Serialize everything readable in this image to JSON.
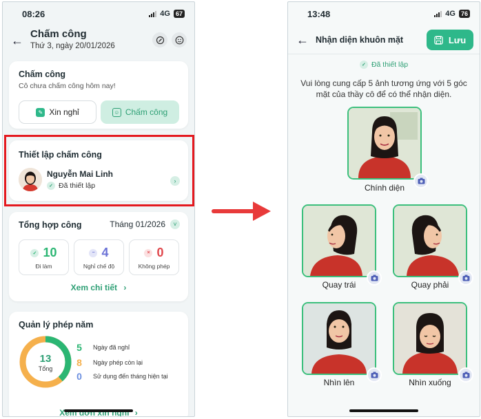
{
  "left": {
    "status": {
      "time": "08:26",
      "network": "4G",
      "battery": "67"
    },
    "header": {
      "title": "Chấm công",
      "date": "Thứ 3, ngày 20/01/2026"
    },
    "attendance": {
      "title": "Chấm công",
      "subtitle": "Cô chưa chấm công hôm nay!",
      "leave_button": "Xin nghỉ",
      "checkin_button": "Chấm công"
    },
    "setup": {
      "title": "Thiết lập chấm công",
      "person_name": "Nguyễn Mai Linh",
      "status": "Đã thiết lập"
    },
    "summary": {
      "title": "Tổng hợp công",
      "month": "Tháng 01/2026",
      "stats": [
        {
          "value": "10",
          "label": "Đi làm",
          "color": "#2bb673"
        },
        {
          "value": "4",
          "label": "Nghỉ chế độ",
          "color": "#6b72d6"
        },
        {
          "value": "0",
          "label": "Không phép",
          "color": "#e0474c"
        }
      ],
      "detail_link": "Xem chi tiết"
    },
    "annual_leave": {
      "title": "Quản lý phép năm",
      "total": "13",
      "total_label": "Tổng",
      "legend": [
        {
          "value": "5",
          "label": "Ngày đã nghỉ",
          "color": "#2bb673"
        },
        {
          "value": "8",
          "label": "Ngày phép còn lại",
          "color": "#f5b04c"
        },
        {
          "value": "0",
          "label": "Sử dụng đến tháng hiện tại",
          "color": "#6b8fe0"
        }
      ],
      "used_fraction": 0.3846,
      "link": "Xem đơn xin nghỉ"
    }
  },
  "right": {
    "status": {
      "time": "13:48",
      "network": "4G",
      "battery": "76"
    },
    "header": {
      "title": "Nhận diện khuôn mặt",
      "save_label": "Lưu"
    },
    "configured": "Đã thiết lập",
    "instruction": "Vui lòng cung cấp 5 ảnh tương ứng với 5 góc mặt của thầy cô để có thể nhận diện.",
    "faces": [
      {
        "label": "Chính diện",
        "pose": "front"
      },
      {
        "label": "Quay trái",
        "pose": "left"
      },
      {
        "label": "Quay phải",
        "pose": "right"
      },
      {
        "label": "Nhìn lên",
        "pose": "up"
      },
      {
        "label": "Nhìn xuống",
        "pose": "down"
      }
    ]
  },
  "colors": {
    "accent": "#2eb88a",
    "highlight_border": "#e4191f",
    "arrow": "#e83a3a"
  }
}
